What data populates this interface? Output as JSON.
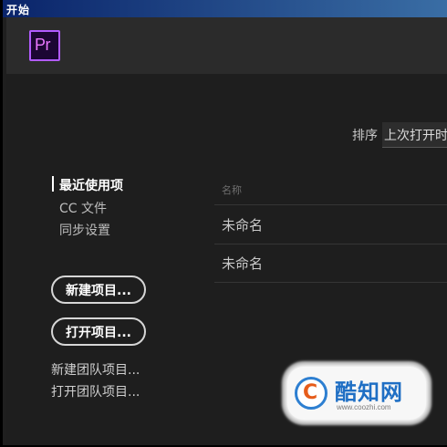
{
  "window": {
    "title": "开始"
  },
  "app": {
    "logo_text": "Pr",
    "logo_color": "#ea77ff",
    "logo_border_color": "#b25bff"
  },
  "sort": {
    "label": "排序",
    "value": "上次打开时间"
  },
  "nav": {
    "items": [
      {
        "label": "最近使用项",
        "active": true
      },
      {
        "label": "CC 文件",
        "active": false
      },
      {
        "label": "同步设置",
        "active": false
      }
    ]
  },
  "actions": {
    "new_project": "新建项目...",
    "open_project": "打开项目...",
    "new_team_project": "新建团队项目...",
    "open_team_project": "打开团队项目..."
  },
  "project_list": {
    "column_header": "名称",
    "rows": [
      {
        "name": "未命名"
      },
      {
        "name": "未命名"
      }
    ]
  },
  "watermark": {
    "logo_letter": "C",
    "text": "酷知网",
    "url": "www.coozhi.com",
    "text_color": "#1f6fc4"
  }
}
